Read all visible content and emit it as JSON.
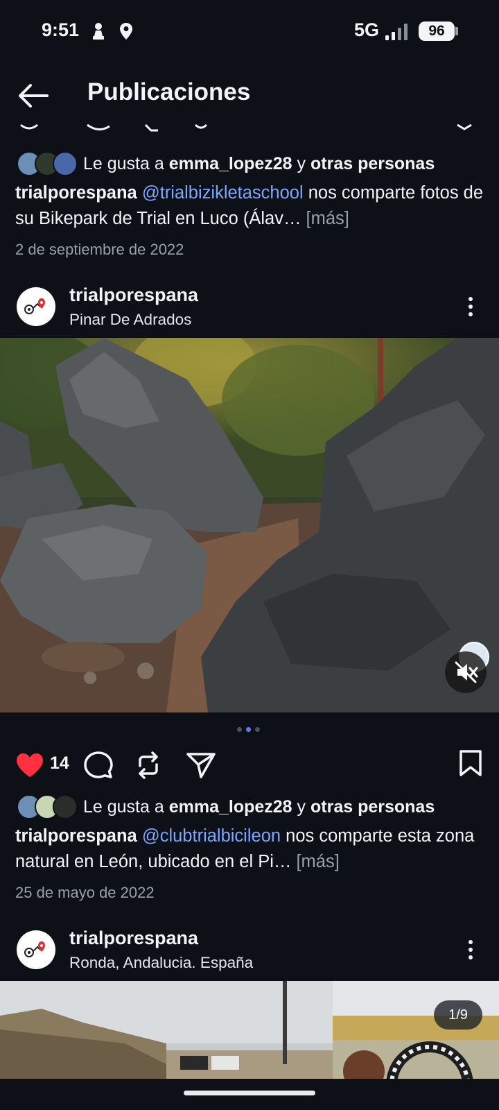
{
  "status_bar": {
    "time": "9:51",
    "network": "5G",
    "battery": "96",
    "icons": [
      "chess-pawn-icon",
      "location-pin-icon",
      "signal-icon",
      "battery-icon"
    ]
  },
  "app_bar": {
    "title": "Publicaciones",
    "back_icon": "arrow-left-icon"
  },
  "posts": [
    {
      "liked_by_prefix": "Le gusta a ",
      "liked_by_user": "emma_lopez28",
      "liked_by_connector": " y ",
      "liked_by_others": "otras personas",
      "caption_user": "trialporespana",
      "caption_mention": "@trialbizikletaschool",
      "caption_text": " nos comparte fotos de su Bikepark de Trial en Luco (Álav…",
      "caption_more": "[más]",
      "date": "2 de septiembre de 2022"
    },
    {
      "username": "trialporespana",
      "location": "Pinar De Adrados",
      "like_count": "14",
      "carousel_dots": 3,
      "carousel_active": 1,
      "liked_by_prefix": "Le gusta a ",
      "liked_by_user": "emma_lopez28",
      "liked_by_connector": " y ",
      "liked_by_others": "otras personas",
      "caption_user": "trialporespana",
      "caption_mention": "@clubtrialbicileon",
      "caption_text": " nos comparte esta zona natural en León, ubicado en el Pi…",
      "caption_more": "[más]",
      "date": "25 de mayo de 2022"
    },
    {
      "username": "trialporespana",
      "location": "Ronda, Andalucia. España",
      "media_counter": "1/9"
    }
  ],
  "colors": {
    "background": "#0d1016",
    "mention": "#7da7ff",
    "like_red": "#ff3040",
    "muted": "#98a0aa",
    "carousel_active": "#5b7cff"
  }
}
